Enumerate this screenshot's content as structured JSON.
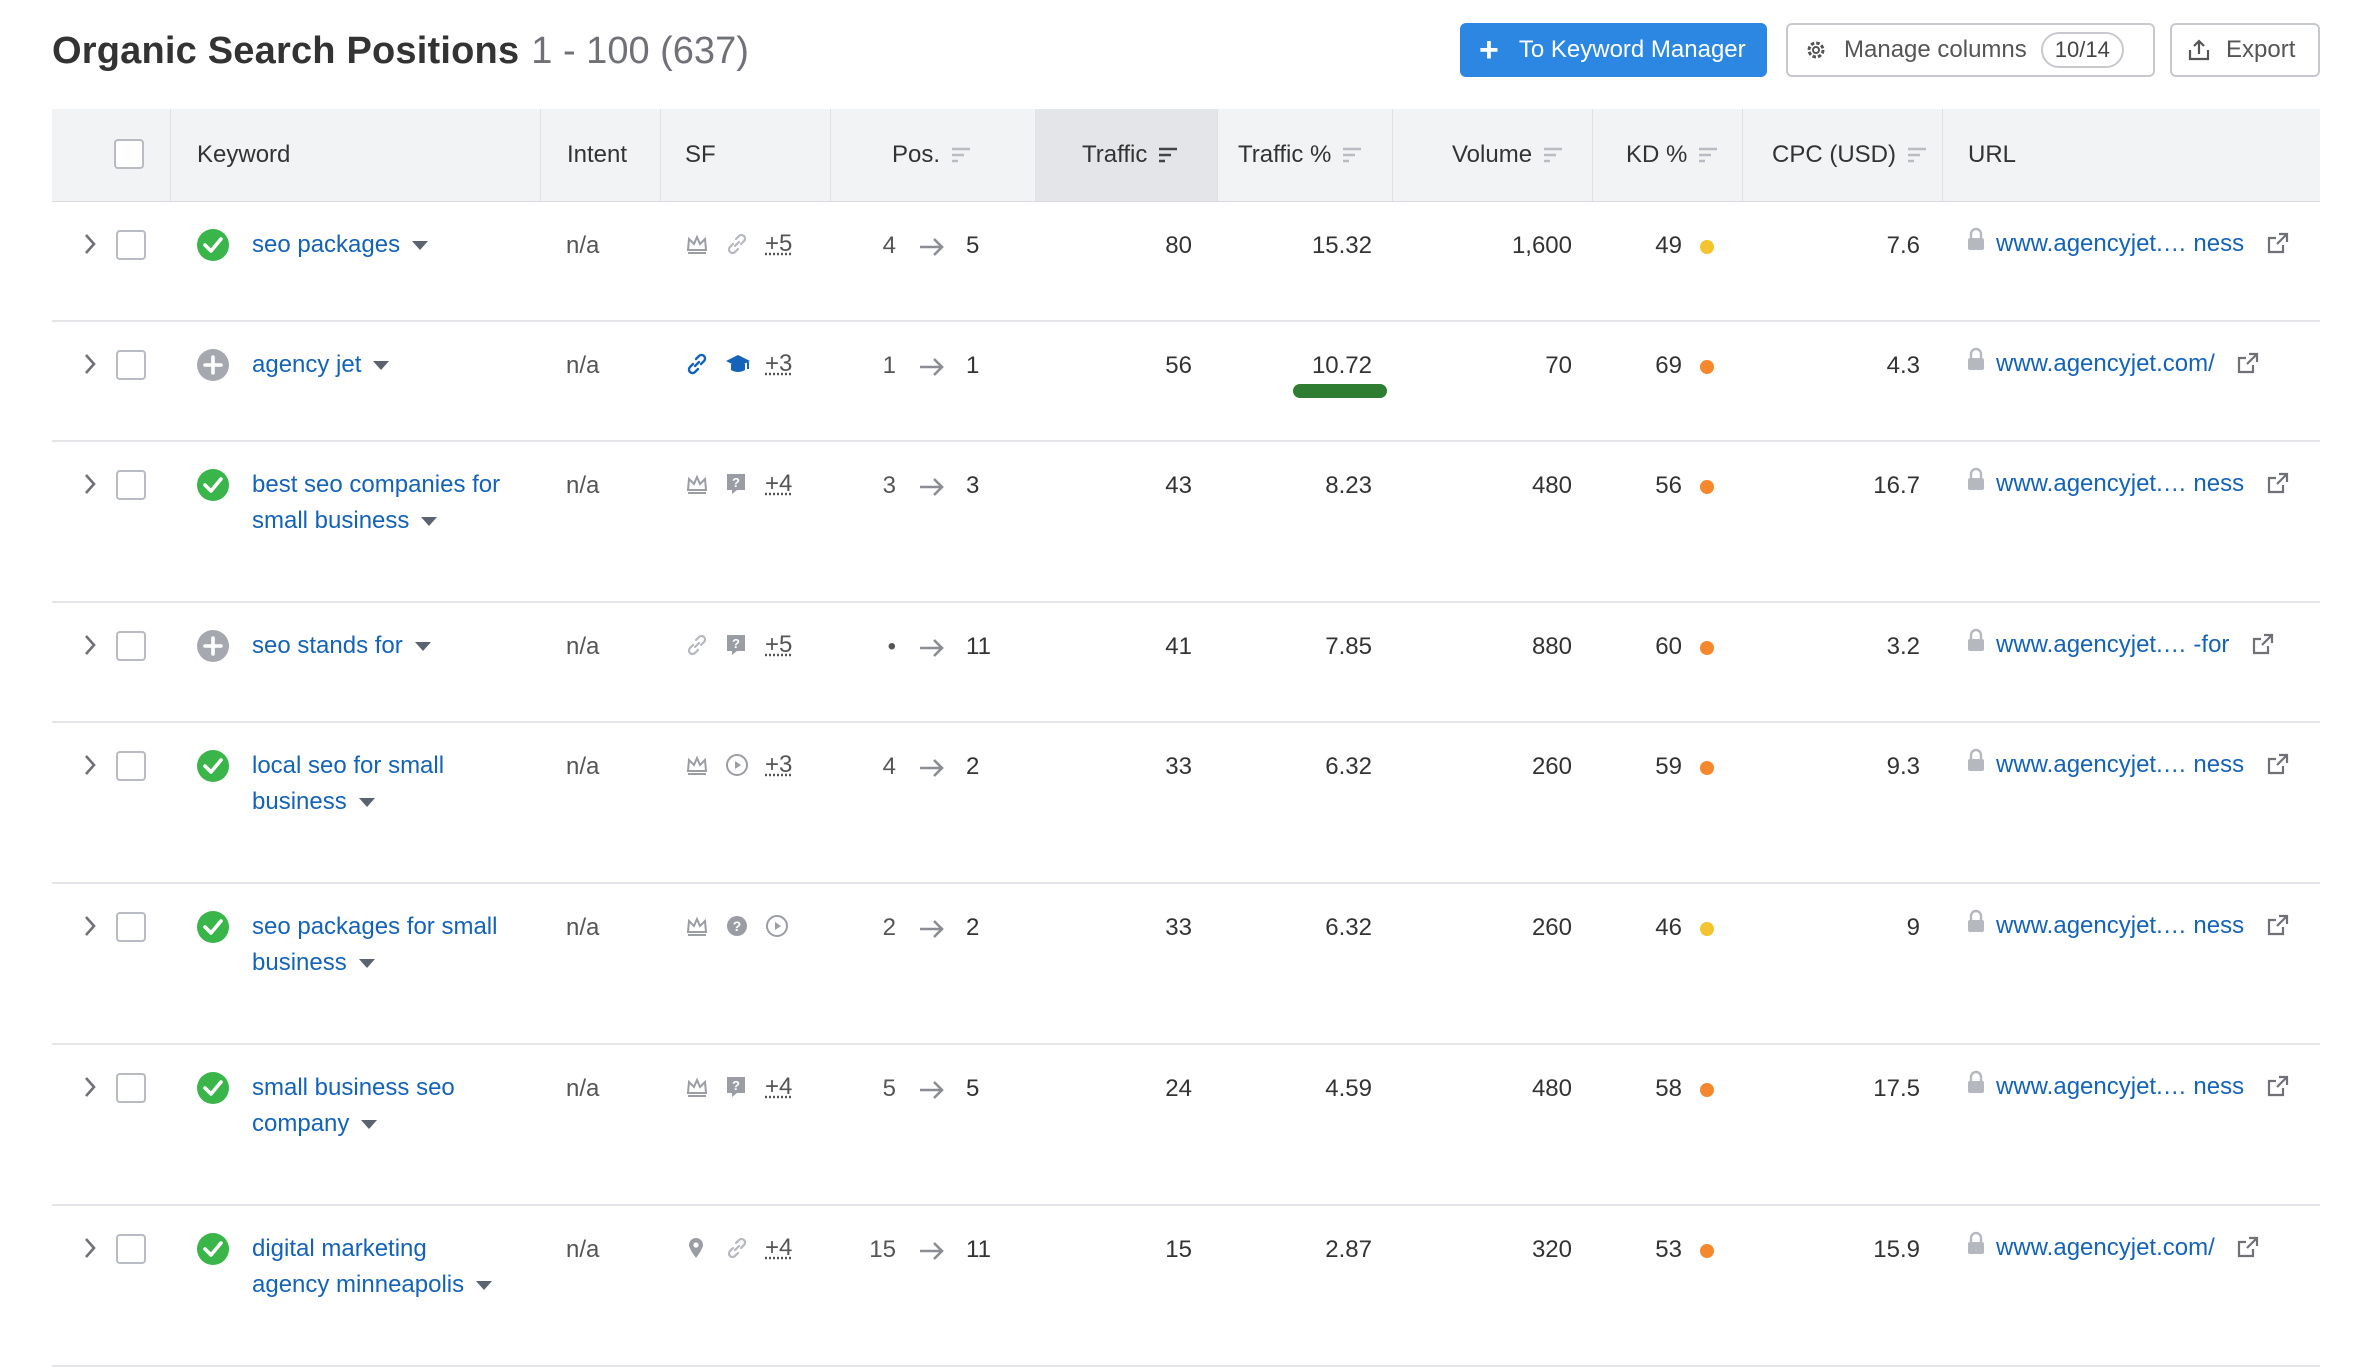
{
  "header": {
    "title": "Organic Search Positions",
    "range": "1 - 100 (637)",
    "to_keyword_manager": "To Keyword Manager",
    "manage_columns": "Manage columns",
    "columns_count": "10/14",
    "export": "Export"
  },
  "columns": {
    "keyword": "Keyword",
    "intent": "Intent",
    "sf": "SF",
    "pos": "Pos.",
    "traffic": "Traffic",
    "traffic_pct": "Traffic %",
    "volume": "Volume",
    "kd": "KD %",
    "cpc": "CPC (USD)",
    "url": "URL"
  },
  "colors": {
    "kd_orange": "#f5872e",
    "kd_yellow": "#f4c430",
    "link": "#1463b8",
    "primary": "#2c87e2"
  },
  "rows": [
    {
      "kw1": "seo packages",
      "kw2": "",
      "status": "check",
      "intent": "n/a",
      "sf_icons": [
        "crown",
        "link"
      ],
      "sf_extra": "+5",
      "pos_from": "4",
      "pos_to": "5",
      "traffic": "80",
      "traffic_pct": "15.32",
      "volume": "1,600",
      "kd": "49",
      "kd_color": "yellow",
      "cpc": "7.6",
      "url": "www.agencyjet.… ness"
    },
    {
      "kw1": "agency jet",
      "kw2": "",
      "status": "plus",
      "intent": "n/a",
      "sf_icons": [
        "link-blue",
        "cap-blue"
      ],
      "sf_extra": "+3",
      "pos_from": "1",
      "pos_to": "1",
      "traffic": "56",
      "traffic_pct": "10.72",
      "volume": "70",
      "kd": "69",
      "kd_color": "orange",
      "cpc": "4.3",
      "url": "www.agencyjet.com/"
    },
    {
      "kw1": "best seo companies for",
      "kw2": "small business",
      "status": "check",
      "intent": "n/a",
      "sf_icons": [
        "crown",
        "qbox"
      ],
      "sf_extra": "+4",
      "pos_from": "3",
      "pos_to": "3",
      "traffic": "43",
      "traffic_pct": "8.23",
      "volume": "480",
      "kd": "56",
      "kd_color": "orange",
      "cpc": "16.7",
      "url": "www.agencyjet.… ness"
    },
    {
      "kw1": "seo stands for",
      "kw2": "",
      "status": "plus",
      "intent": "n/a",
      "sf_icons": [
        "link",
        "qbox"
      ],
      "sf_extra": "+5",
      "pos_from": "•",
      "pos_to": "11",
      "traffic": "41",
      "traffic_pct": "7.85",
      "volume": "880",
      "kd": "60",
      "kd_color": "orange",
      "cpc": "3.2",
      "url": "www.agencyjet.… -for"
    },
    {
      "kw1": "local seo for small",
      "kw2": "business",
      "status": "check",
      "intent": "n/a",
      "sf_icons": [
        "crown",
        "play"
      ],
      "sf_extra": "+3",
      "pos_from": "4",
      "pos_to": "2",
      "traffic": "33",
      "traffic_pct": "6.32",
      "volume": "260",
      "kd": "59",
      "kd_color": "orange",
      "cpc": "9.3",
      "url": "www.agencyjet.… ness"
    },
    {
      "kw1": "seo packages for small",
      "kw2": "business",
      "status": "check",
      "intent": "n/a",
      "sf_icons": [
        "crown",
        "qcircle",
        "play"
      ],
      "sf_extra": "",
      "pos_from": "2",
      "pos_to": "2",
      "traffic": "33",
      "traffic_pct": "6.32",
      "volume": "260",
      "kd": "46",
      "kd_color": "yellow",
      "cpc": "9",
      "url": "www.agencyjet.… ness"
    },
    {
      "kw1": "small business seo",
      "kw2": "company",
      "status": "check",
      "intent": "n/a",
      "sf_icons": [
        "crown",
        "qbox"
      ],
      "sf_extra": "+4",
      "pos_from": "5",
      "pos_to": "5",
      "traffic": "24",
      "traffic_pct": "4.59",
      "volume": "480",
      "kd": "58",
      "kd_color": "orange",
      "cpc": "17.5",
      "url": "www.agencyjet.… ness"
    },
    {
      "kw1": "digital marketing",
      "kw2": "agency minneapolis",
      "status": "check",
      "intent": "n/a",
      "sf_icons": [
        "pin",
        "link"
      ],
      "sf_extra": "+4",
      "pos_from": "15",
      "pos_to": "11",
      "traffic": "15",
      "traffic_pct": "2.87",
      "volume": "320",
      "kd": "53",
      "kd_color": "orange",
      "cpc": "15.9",
      "url": "www.agencyjet.com/"
    }
  ]
}
